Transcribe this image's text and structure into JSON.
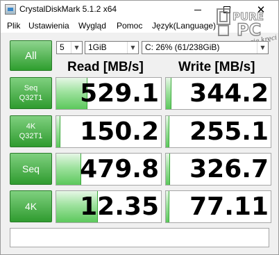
{
  "window": {
    "title": "CrystalDiskMark 5.1.2 x64",
    "minimize_label": "",
    "close_label": "✕"
  },
  "menu": {
    "items": [
      "Plik",
      "Ustawienia",
      "Wygląd",
      "Pomoc",
      "Język(Language)"
    ]
  },
  "watermark": {
    "brand_top": "PURE",
    "brand_bottom": "PC",
    "signature": "Nowy, co się kręci"
  },
  "controls": {
    "all_label": "All",
    "count": "5",
    "size": "1GiB",
    "drive": "C: 26% (61/238GiB)"
  },
  "headers": {
    "read": "Read [MB/s]",
    "write": "Write [MB/s]"
  },
  "rows": [
    {
      "label_line1": "Seq",
      "label_line2": "Q32T1",
      "read": "529.1",
      "write": "344.2",
      "read_fill": 0.3,
      "write_fill": 0.05
    },
    {
      "label_line1": "4K",
      "label_line2": "Q32T1",
      "read": "150.2",
      "write": "255.1",
      "read_fill": 0.04,
      "write_fill": 0.03
    },
    {
      "label_line1": "Seq",
      "label_line2": "",
      "read": "479.8",
      "write": "326.7",
      "read_fill": 0.24,
      "write_fill": 0.04
    },
    {
      "label_line1": "4K",
      "label_line2": "",
      "read": "12.35",
      "write": "77.11",
      "read_fill": 0.4,
      "write_fill": 0.03
    }
  ],
  "comment": ""
}
